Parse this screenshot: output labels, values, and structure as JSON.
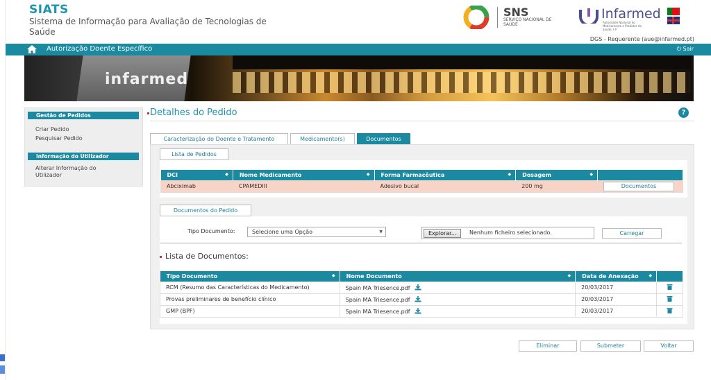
{
  "header": {
    "app_title": "SIATS",
    "app_subtitle": "Sistema de Informação para Avaliação de Tecnologias de Saúde",
    "sns_name": "SNS",
    "sns_subtitle": "SERVIÇO NACIONAL DE SAÚDE",
    "infarmed_name": "Infarmed",
    "infarmed_subtitle": "Autoridade Nacional do Medicamento e Produtos de Saúde, I.P.",
    "user": "DGS - Requerente (aue@infarmed.pt)"
  },
  "navbar": {
    "title": "Autorização Doente Específico",
    "logout": "Sair"
  },
  "banner": {
    "text": "infarmed"
  },
  "sidebar": {
    "section1": "Gestão de Pedidos",
    "items1": [
      "Criar Pedido",
      "Pesquisar Pedido"
    ],
    "section2": "Informação do Utilizador",
    "items2": [
      "Alterar Informação do Utilizador"
    ]
  },
  "main": {
    "page_title": "Detalhes do Pedido",
    "help": "?",
    "tabs": [
      "Caracterização do Doente e Tratamento",
      "Medicamento(s)",
      "Documentos"
    ],
    "lista_pedidos_tab": "Lista de Pedidos",
    "pedidos_headers": [
      "DCI",
      "Nome Medicamento",
      "Forma Farmacêutica",
      "Dosagem",
      ""
    ],
    "pedidos_row": {
      "dci": "Abciximab",
      "nome": "CPAMEDIII",
      "forma": "Adesivo bucal",
      "dosagem": "200 mg",
      "action": "Documentos"
    },
    "documentos_pedido_tab": "Documentos do Pedido",
    "tipo_documento_label": "Tipo Documento:",
    "tipo_documento_value": "Selecione uma Opção",
    "browse_label": "Explorar...",
    "file_status": "Nenhum ficheiro selecionado.",
    "upload_label": "Carregar",
    "list_title": "Lista de Documentos:",
    "docs_headers": [
      "Tipo Documento",
      "Nome Documento",
      "Data de Anexação",
      ""
    ],
    "docs_rows": [
      {
        "tipo": "RCM (Resumo das Características do Medicamento)",
        "nome": "Spain MA Triesence.pdf",
        "data": "20/03/2017"
      },
      {
        "tipo": "Provas preliminares de benefício clínico",
        "nome": "Spain MA Triesence.pdf",
        "data": "20/03/2017"
      },
      {
        "tipo": "GMP (BPF)",
        "nome": "Spain MA Triesence.pdf",
        "data": "20/03/2017"
      }
    ]
  },
  "footer": {
    "delete": "Eliminar",
    "submit": "Submeter",
    "back": "Voltar"
  },
  "colors": {
    "accent": "#1b8aa1",
    "title": "#1f94ad",
    "highlight_row": "#f8d3c6"
  }
}
